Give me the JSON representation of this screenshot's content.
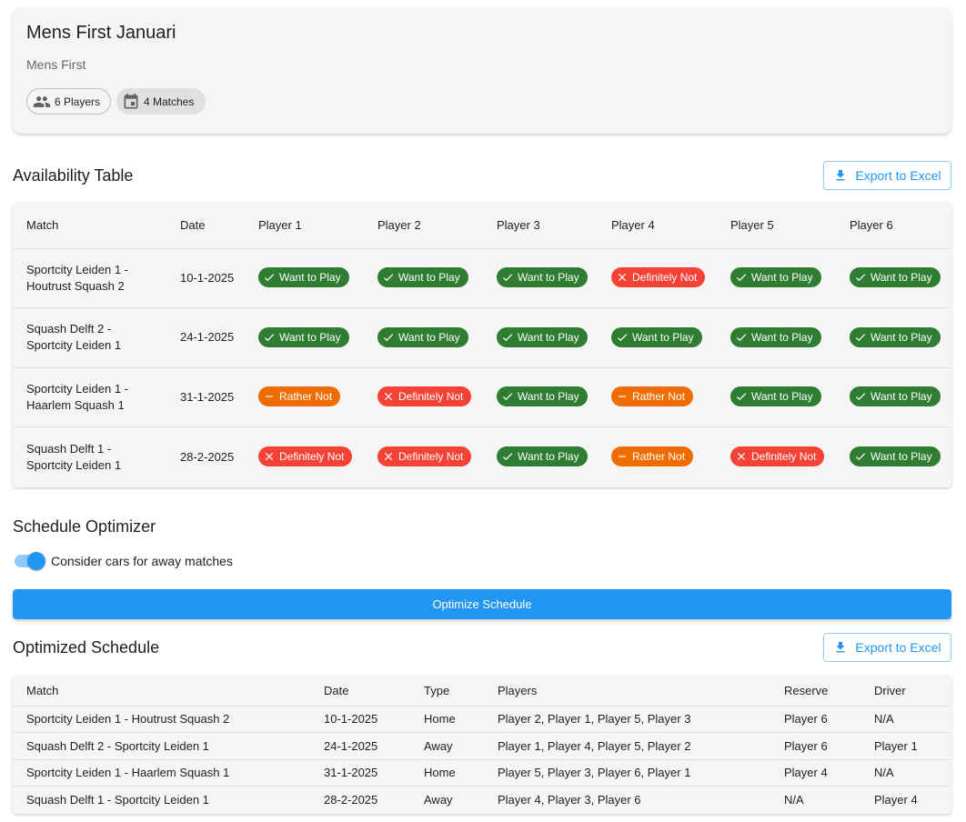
{
  "team": {
    "title": "Mens First Januari",
    "subtitle": "Mens First",
    "players_chip": "6 Players",
    "matches_chip": "4 Matches"
  },
  "availability": {
    "title": "Availability Table",
    "export_label": "Export to Excel",
    "headers": [
      "Match",
      "Date",
      "Player 1",
      "Player 2",
      "Player 3",
      "Player 4",
      "Player 5",
      "Player 6"
    ],
    "rows": [
      {
        "match_line1": "Sportcity Leiden 1 -",
        "match_line2": "Houtrust Squash 2",
        "date": "10-1-2025",
        "statuses": [
          "Want to Play",
          "Want to Play",
          "Want to Play",
          "Definitely Not",
          "Want to Play",
          "Want to Play"
        ]
      },
      {
        "match_line1": "Squash Delft 2 -",
        "match_line2": "Sportcity Leiden 1",
        "date": "24-1-2025",
        "statuses": [
          "Want to Play",
          "Want to Play",
          "Want to Play",
          "Want to Play",
          "Want to Play",
          "Want to Play"
        ]
      },
      {
        "match_line1": "Sportcity Leiden 1 -",
        "match_line2": "Haarlem Squash 1",
        "date": "31-1-2025",
        "statuses": [
          "Rather Not",
          "Definitely Not",
          "Want to Play",
          "Rather Not",
          "Want to Play",
          "Want to Play"
        ]
      },
      {
        "match_line1": "Squash Delft 1 -",
        "match_line2": "Sportcity Leiden 1",
        "date": "28-2-2025",
        "statuses": [
          "Definitely Not",
          "Definitely Not",
          "Want to Play",
          "Rather Not",
          "Definitely Not",
          "Want to Play"
        ]
      }
    ]
  },
  "optimizer": {
    "title": "Schedule Optimizer",
    "toggle_label": "Consider cars for away matches",
    "toggle_on": true,
    "button_label": "Optimize Schedule"
  },
  "schedule": {
    "title": "Optimized Schedule",
    "export_label": "Export to Excel",
    "headers": [
      "Match",
      "Date",
      "Type",
      "Players",
      "Reserve",
      "Driver"
    ],
    "rows": [
      {
        "match": "Sportcity Leiden 1 - Houtrust Squash 2",
        "date": "10-1-2025",
        "type": "Home",
        "players": "Player 2, Player 1, Player 5, Player 3",
        "reserve": "Player 6",
        "driver": "N/A"
      },
      {
        "match": "Squash Delft 2 - Sportcity Leiden 1",
        "date": "24-1-2025",
        "type": "Away",
        "players": "Player 1, Player 4, Player 5, Player 2",
        "reserve": "Player 6",
        "driver": "Player 1"
      },
      {
        "match": "Sportcity Leiden 1 - Haarlem Squash 1",
        "date": "31-1-2025",
        "type": "Home",
        "players": "Player 5, Player 3, Player 6, Player 1",
        "reserve": "Player 4",
        "driver": "N/A"
      },
      {
        "match": "Squash Delft 1 - Sportcity Leiden 1",
        "date": "28-2-2025",
        "type": "Away",
        "players": "Player 4, Player 3, Player 6",
        "reserve": "N/A",
        "driver": "Player 4"
      }
    ]
  },
  "colors": {
    "want": "#2e7d32",
    "definitely_not": "#f44336",
    "rather_not": "#ef6c00",
    "primary": "#2196f3"
  }
}
